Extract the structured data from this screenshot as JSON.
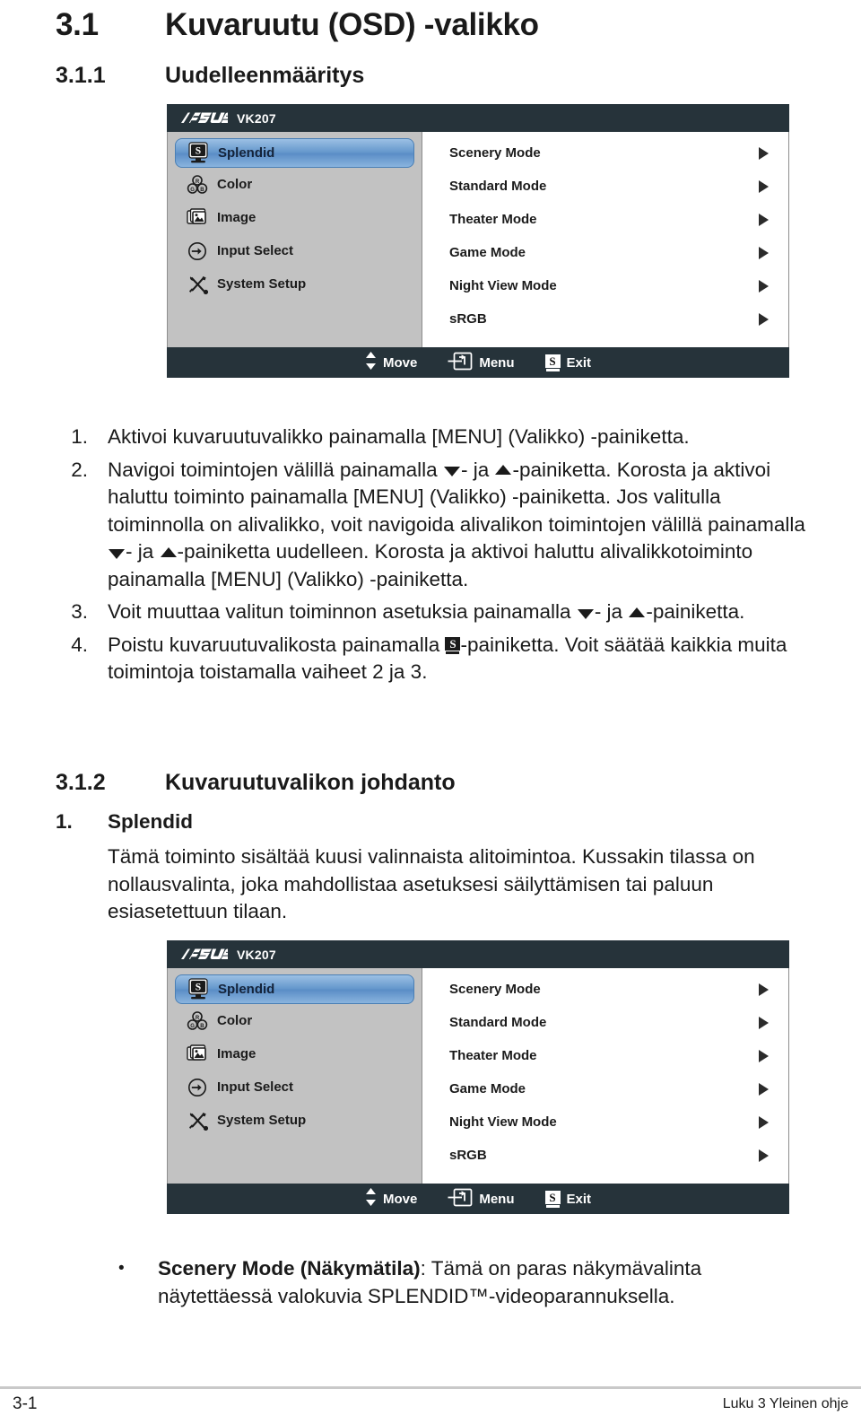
{
  "headings": {
    "section_number": "3.1",
    "section_title": "Kuvaruutu (OSD) -valikko",
    "sub1_number": "3.1.1",
    "sub1_title": "Uudelleenmääritys",
    "sub2_number": "3.1.2",
    "sub2_title": "Kuvaruutuvalikon johdanto"
  },
  "osd": {
    "brand": "ASUS",
    "model": "VK207",
    "nav_items": [
      {
        "label": "Splendid",
        "icon": "splendid-icon",
        "selected": true
      },
      {
        "label": "Color",
        "icon": "color-rgb-icon",
        "selected": false
      },
      {
        "label": "Image",
        "icon": "image-icon",
        "selected": false
      },
      {
        "label": "Input Select",
        "icon": "input-select-icon",
        "selected": false
      },
      {
        "label": "System Setup",
        "icon": "system-setup-icon",
        "selected": false
      }
    ],
    "options": [
      "Scenery Mode",
      "Standard Mode",
      "Theater Mode",
      "Game Mode",
      "Night View Mode",
      "sRGB"
    ],
    "footer": [
      {
        "label": "Move",
        "icon": "updown-arrows-icon"
      },
      {
        "label": "Menu",
        "icon": "menu-button-icon"
      },
      {
        "label": "Exit",
        "icon": "splendid-s-icon"
      }
    ],
    "colors": {
      "titlebar": "#26333a",
      "sidebar": "#c2c2c2",
      "highlight": "#6497cc",
      "panel": "#ffffff"
    }
  },
  "steps": [
    {
      "number": "1.",
      "parts": [
        {
          "type": "text",
          "value": "Aktivoi kuvaruutuvalikko painamalla [MENU] (Valikko) -painiketta."
        }
      ]
    },
    {
      "number": "2.",
      "parts": [
        {
          "type": "text",
          "value": "Navigoi toimintojen välillä painamalla "
        },
        {
          "type": "icon",
          "value": "triangle-down-icon"
        },
        {
          "type": "text",
          "value": "- ja "
        },
        {
          "type": "icon",
          "value": "triangle-up-icon"
        },
        {
          "type": "text",
          "value": "-painiketta. Korosta ja aktivoi haluttu toiminto painamalla [MENU] (Valikko) -painiketta. Jos valitulla toiminnolla on alivalikko, voit navigoida alivalikon toimintojen välillä painamalla "
        },
        {
          "type": "icon",
          "value": "triangle-down-icon"
        },
        {
          "type": "text",
          "value": "- ja "
        },
        {
          "type": "icon",
          "value": "triangle-up-icon"
        },
        {
          "type": "text",
          "value": "-painiketta uudelleen. Korosta ja aktivoi haluttu alivalikkotoiminto painamalla [MENU] (Valikko) -painiketta."
        }
      ]
    },
    {
      "number": "3.",
      "parts": [
        {
          "type": "text",
          "value": "Voit muuttaa valitun toiminnon asetuksia painamalla "
        },
        {
          "type": "icon",
          "value": "triangle-down-icon"
        },
        {
          "type": "text",
          "value": "- ja "
        },
        {
          "type": "icon",
          "value": "triangle-up-icon"
        },
        {
          "type": "text",
          "value": "-painiketta."
        }
      ]
    },
    {
      "number": "4.",
      "parts": [
        {
          "type": "text",
          "value": "Poistu kuvaruutuvalikosta painamalla "
        },
        {
          "type": "icon",
          "value": "splendid-s-icon"
        },
        {
          "type": "text",
          "value": "-painiketta. Voit säätää kaikkia muita toimintoja toistamalla vaiheet 2 ja 3."
        }
      ]
    }
  ],
  "splendid_section": {
    "number": "1.",
    "title": "Splendid",
    "paragraph": "Tämä toiminto sisältää kuusi valinnaista alitoimintoa. Kussakin tilassa on nollausvalinta, joka mahdollistaa asetuksesi säilyttämisen tai paluun esiasetettuun tilaan.",
    "bullet": {
      "marker": "•",
      "bold_part": "Scenery Mode (Näkymätila)",
      "rest": ": Tämä on paras näkymävalinta näytettäessä valokuvia SPLENDID™-videoparannuksella."
    }
  },
  "footer": {
    "page_number": "3-1",
    "chapter_label": "Luku 3 Yleinen ohje"
  }
}
